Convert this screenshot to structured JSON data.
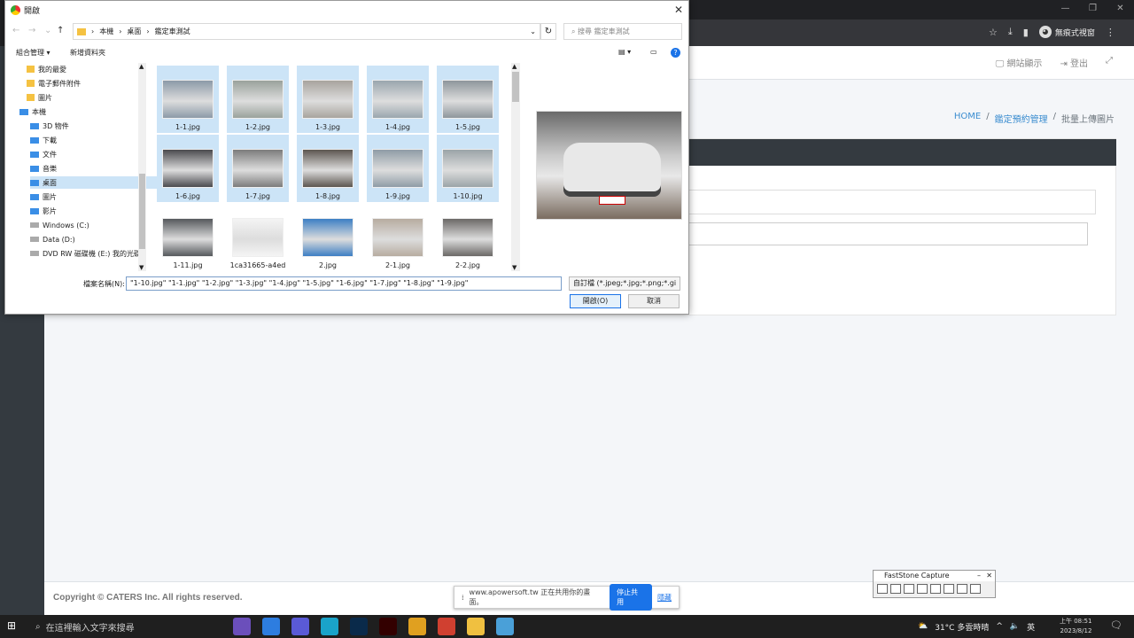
{
  "browser": {
    "guest_label": "無痕式視窗",
    "win_controls": [
      "—",
      "❐",
      "✕"
    ],
    "icons": [
      "star-icon",
      "download-icon",
      "sidebar-icon"
    ]
  },
  "site": {
    "topbar": {
      "site_display": "網站顯示",
      "logout": "登出",
      "expand_icon": "⤢"
    },
    "breadcrumb": {
      "home": "HOME",
      "sep": "/",
      "section": "鑑定預約管理",
      "current": "批量上傳圖片"
    },
    "copyright": "Copyright © CATERS Inc. All rights reserved."
  },
  "share_bar": {
    "text": "www.apowersoft.tw 正在共用你的畫面。",
    "stop": "停止共用",
    "hide": "隱藏"
  },
  "faststone": {
    "title": "FastStone Capture"
  },
  "dialog": {
    "title": "開啟",
    "address": {
      "root": "本機",
      "p1": "桌面",
      "p2": "鑑定車測試"
    },
    "search_placeholder": "搜尋 鑑定車測試",
    "toolbar": {
      "organize": "組合管理 ▾",
      "new_folder": "新增資料夾",
      "help": "?"
    },
    "tree": [
      {
        "label": "我的最愛",
        "type": "folder"
      },
      {
        "label": "電子郵件附件",
        "type": "folder"
      },
      {
        "label": "圖片",
        "type": "folder"
      },
      {
        "label": "本機",
        "type": "pc"
      },
      {
        "label": "3D 物件",
        "type": "3d"
      },
      {
        "label": "下載",
        "type": "download"
      },
      {
        "label": "文件",
        "type": "doc"
      },
      {
        "label": "音樂",
        "type": "music"
      },
      {
        "label": "桌面",
        "type": "desktop",
        "selected": true
      },
      {
        "label": "圖片",
        "type": "pic"
      },
      {
        "label": "影片",
        "type": "video"
      },
      {
        "label": "Windows (C:)",
        "type": "drive"
      },
      {
        "label": "Data (D:)",
        "type": "drive"
      },
      {
        "label": "DVD RW 磁碟機 (E:) 我的光碟",
        "type": "dvd"
      }
    ],
    "files": [
      {
        "name": "1-1.jpg",
        "selected": true,
        "color": "#8c9aa8"
      },
      {
        "name": "1-2.jpg",
        "selected": true,
        "color": "#9aa29c"
      },
      {
        "name": "1-3.jpg",
        "selected": true,
        "color": "#a8a49e"
      },
      {
        "name": "1-4.jpg",
        "selected": true,
        "color": "#9aa6ae"
      },
      {
        "name": "1-5.jpg",
        "selected": true,
        "color": "#8e969c"
      },
      {
        "name": "1-6.jpg",
        "selected": true,
        "color": "#4a4a4e"
      },
      {
        "name": "1-7.jpg",
        "selected": true,
        "color": "#7c7c7c"
      },
      {
        "name": "1-8.jpg",
        "selected": true,
        "color": "#5c5650"
      },
      {
        "name": "1-9.jpg",
        "selected": true,
        "color": "#8f9ca6"
      },
      {
        "name": "1-10.jpg",
        "selected": true,
        "color": "#9ba4a8"
      },
      {
        "name": "1-11.jpg",
        "selected": false,
        "color": "#55585c"
      },
      {
        "name": "1ca31665-a4ed",
        "selected": false,
        "color": "#f4f4f4"
      },
      {
        "name": "2.jpg",
        "selected": false,
        "color": "#3d7fc4"
      },
      {
        "name": "2-1.jpg",
        "selected": false,
        "color": "#b7aca0"
      },
      {
        "name": "2-2.jpg",
        "selected": false,
        "color": "#6b6866"
      }
    ],
    "filename_label": "檔案名稱(N):",
    "filename_value": "\"1-10.jpg\" \"1-1.jpg\" \"1-2.jpg\" \"1-3.jpg\" \"1-4.jpg\" \"1-5.jpg\" \"1-6.jpg\" \"1-7.jpg\" \"1-8.jpg\" \"1-9.jpg\"",
    "filter": "自訂檔 (*.jpeg;*.jpg;*.png;*.gi",
    "open_button": "開啟(O)",
    "cancel_button": "取消"
  },
  "taskbar": {
    "search_placeholder": "在這裡輸入文字來搜尋",
    "apps": [
      {
        "name": "task-view-icon",
        "color": "#1f1f1f"
      },
      {
        "name": "app-icon",
        "color": "#6b4fbb"
      },
      {
        "name": "store-icon",
        "color": "#2d7de0"
      },
      {
        "name": "media-icon",
        "color": "#5a5ad6"
      },
      {
        "name": "edge-icon",
        "color": "#1aa3c9"
      },
      {
        "name": "photoshop-icon",
        "color": "#0a2a4a"
      },
      {
        "name": "illustrator-icon",
        "color": "#330000"
      },
      {
        "name": "chrome-icon",
        "color": "#e0a020"
      },
      {
        "name": "chrome-icon-2",
        "color": "#d04030"
      },
      {
        "name": "explorer-icon",
        "color": "#f0c040"
      },
      {
        "name": "notepad-icon",
        "color": "#4aa0d8"
      }
    ],
    "weather": "31°C 多雲時晴",
    "ime": "英",
    "time": "上午 08:51",
    "date": "2023/8/12"
  }
}
